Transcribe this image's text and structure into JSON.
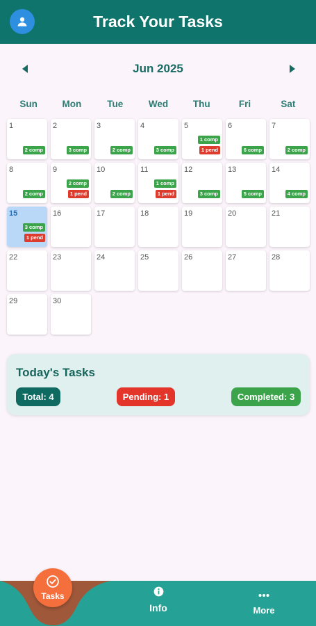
{
  "app": {
    "title": "Track Your Tasks"
  },
  "calendar": {
    "month_label": "Jun 2025",
    "weekdays": [
      "Sun",
      "Mon",
      "Tue",
      "Wed",
      "Thu",
      "Fri",
      "Sat"
    ],
    "leading_blanks": 0,
    "today": 15,
    "days": [
      {
        "day": "1",
        "comp": "2 comp",
        "pend": ""
      },
      {
        "day": "2",
        "comp": "3 comp",
        "pend": ""
      },
      {
        "day": "3",
        "comp": "2 comp",
        "pend": ""
      },
      {
        "day": "4",
        "comp": "3 comp",
        "pend": ""
      },
      {
        "day": "5",
        "comp": "1 comp",
        "pend": "1 pend"
      },
      {
        "day": "6",
        "comp": "6 comp",
        "pend": ""
      },
      {
        "day": "7",
        "comp": "2 comp",
        "pend": ""
      },
      {
        "day": "8",
        "comp": "2 comp",
        "pend": ""
      },
      {
        "day": "9",
        "comp": "2 comp",
        "pend": "1 pend"
      },
      {
        "day": "10",
        "comp": "2 comp",
        "pend": ""
      },
      {
        "day": "11",
        "comp": "1 comp",
        "pend": "1 pend"
      },
      {
        "day": "12",
        "comp": "3 comp",
        "pend": ""
      },
      {
        "day": "13",
        "comp": "5 comp",
        "pend": ""
      },
      {
        "day": "14",
        "comp": "4 comp",
        "pend": ""
      },
      {
        "day": "15",
        "comp": "3 comp",
        "pend": "1 pend"
      },
      {
        "day": "16",
        "comp": "",
        "pend": ""
      },
      {
        "day": "17",
        "comp": "",
        "pend": ""
      },
      {
        "day": "18",
        "comp": "",
        "pend": ""
      },
      {
        "day": "19",
        "comp": "",
        "pend": ""
      },
      {
        "day": "20",
        "comp": "",
        "pend": ""
      },
      {
        "day": "21",
        "comp": "",
        "pend": ""
      },
      {
        "day": "22",
        "comp": "",
        "pend": ""
      },
      {
        "day": "23",
        "comp": "",
        "pend": ""
      },
      {
        "day": "24",
        "comp": "",
        "pend": ""
      },
      {
        "day": "25",
        "comp": "",
        "pend": ""
      },
      {
        "day": "26",
        "comp": "",
        "pend": ""
      },
      {
        "day": "27",
        "comp": "",
        "pend": ""
      },
      {
        "day": "28",
        "comp": "",
        "pend": ""
      },
      {
        "day": "29",
        "comp": "",
        "pend": ""
      },
      {
        "day": "30",
        "comp": "",
        "pend": ""
      }
    ]
  },
  "summary": {
    "title": "Today's Tasks",
    "total": "Total: 4",
    "pending": "Pending: 1",
    "completed": "Completed: 3"
  },
  "bottom_nav": {
    "tasks": "Tasks",
    "info": "Info",
    "more": "More"
  },
  "icons": {
    "avatar": "person-icon",
    "prev": "chevron-left-icon",
    "next": "chevron-right-icon",
    "tasks": "check-circle-icon",
    "info": "info-icon",
    "more": "more-dots-icon"
  },
  "colors": {
    "primary": "#0f746b",
    "nav": "#26a196",
    "accent": "#f46f3c",
    "completed": "#3ba44b",
    "pending": "#de3b2f",
    "today": "#b9d8f7"
  }
}
